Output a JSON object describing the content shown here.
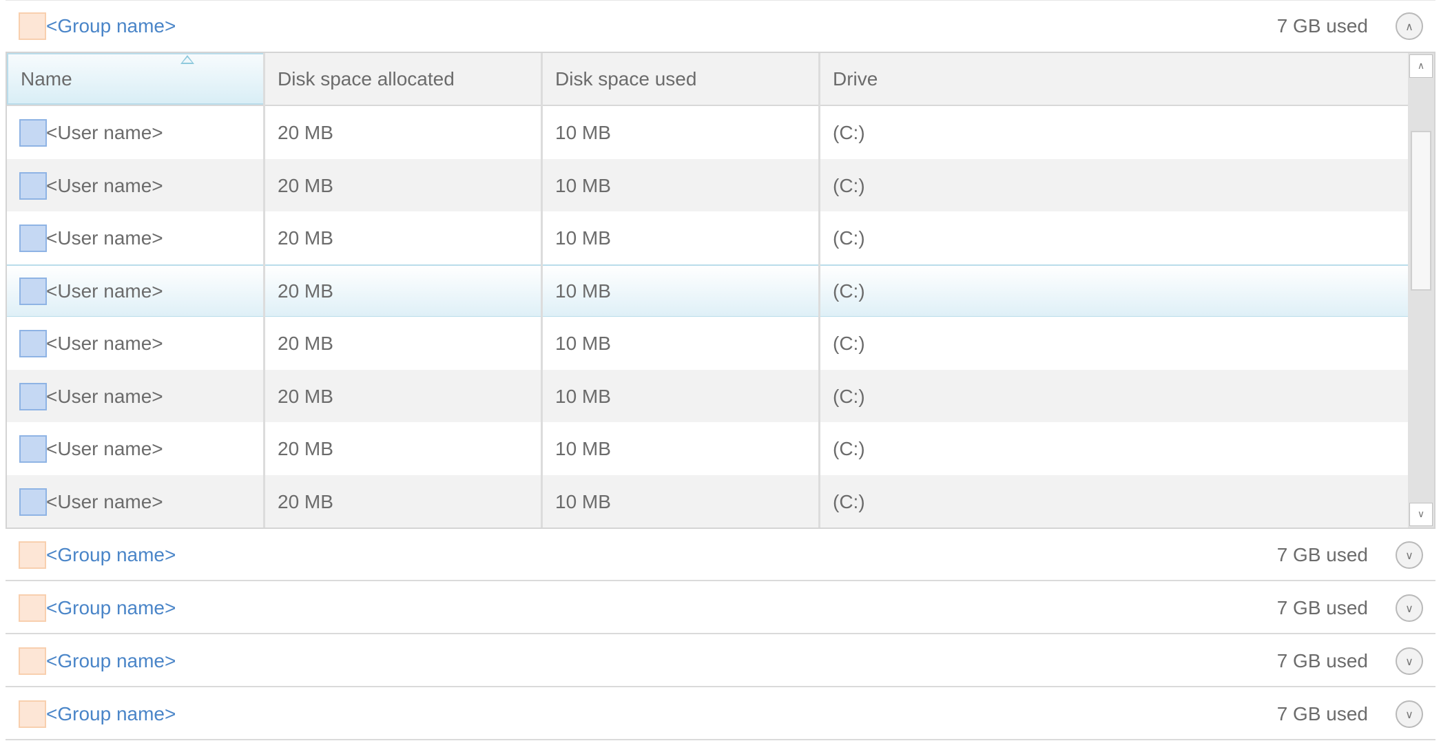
{
  "groups": [
    {
      "name": "<Group name>",
      "used": "7 GB used",
      "expanded": true,
      "toggle": "∧"
    },
    {
      "name": "<Group name>",
      "used": "7 GB used",
      "expanded": false,
      "toggle": "∨"
    },
    {
      "name": "<Group name>",
      "used": "7 GB used",
      "expanded": false,
      "toggle": "∨"
    },
    {
      "name": "<Group name>",
      "used": "7 GB used",
      "expanded": false,
      "toggle": "∨"
    },
    {
      "name": "<Group name>",
      "used": "7 GB used",
      "expanded": false,
      "toggle": "∨"
    }
  ],
  "table": {
    "columns": [
      "Name",
      "Disk space allocated",
      "Disk space used",
      "Drive"
    ],
    "sort_column": "Name",
    "sort_direction": "ascending",
    "rows": [
      {
        "name": "<User name>",
        "allocated": "20 MB",
        "used": "10 MB",
        "drive": "(C:)"
      },
      {
        "name": "<User name>",
        "allocated": "20 MB",
        "used": "10 MB",
        "drive": "(C:)"
      },
      {
        "name": "<User name>",
        "allocated": "20 MB",
        "used": "10 MB",
        "drive": "(C:)"
      },
      {
        "name": "<User name>",
        "allocated": "20 MB",
        "used": "10 MB",
        "drive": "(C:)",
        "selected": true
      },
      {
        "name": "<User name>",
        "allocated": "20 MB",
        "used": "10 MB",
        "drive": "(C:)"
      },
      {
        "name": "<User name>",
        "allocated": "20 MB",
        "used": "10 MB",
        "drive": "(C:)"
      },
      {
        "name": "<User name>",
        "allocated": "20 MB",
        "used": "10 MB",
        "drive": "(C:)"
      },
      {
        "name": "<User name>",
        "allocated": "20 MB",
        "used": "10 MB",
        "drive": "(C:)"
      }
    ]
  },
  "scrollbar": {
    "up": "∧",
    "down": "∨"
  },
  "colors": {
    "group_link": "#4a85c8",
    "group_icon_fill": "#fde6d6",
    "user_icon_fill": "#c5d8f3",
    "selection_border": "#b9dcea"
  }
}
